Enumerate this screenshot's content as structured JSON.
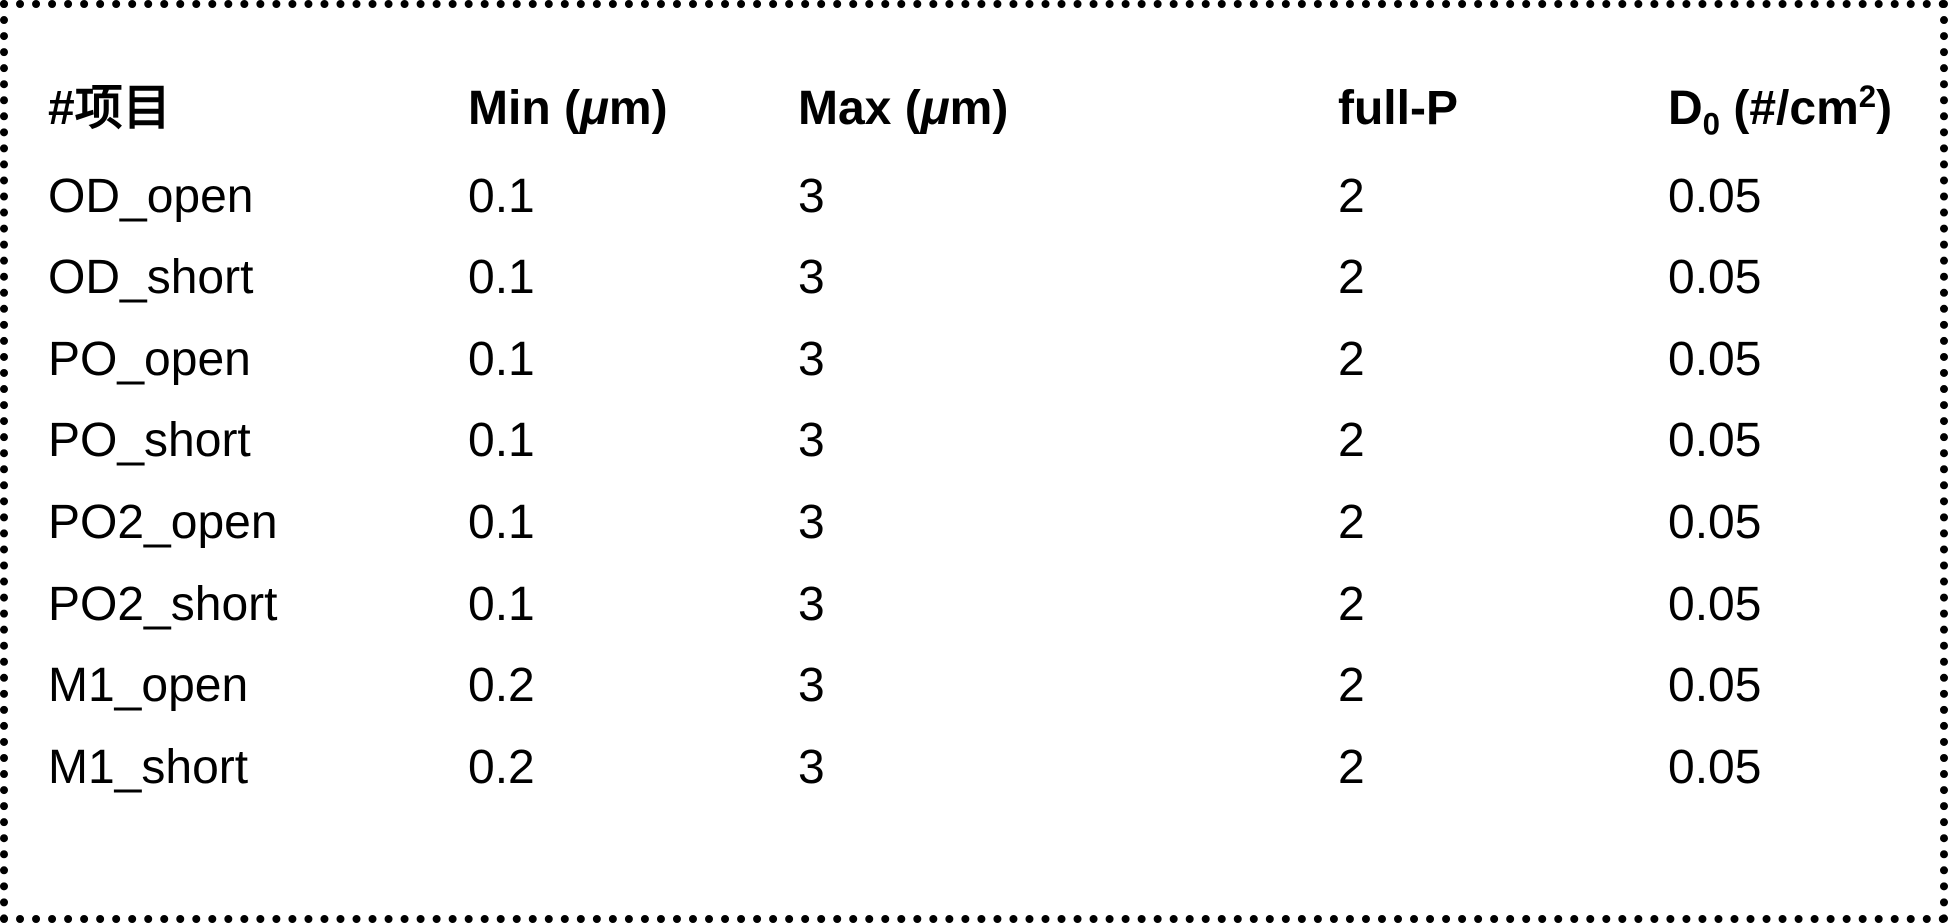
{
  "table": {
    "headers": {
      "item_prefix": "#",
      "item_label": "项目",
      "min_label": "Min (",
      "min_unit_mu": "μ",
      "min_unit_m": "m)",
      "max_label": "Max (",
      "max_unit_mu": "μ",
      "max_unit_m": "m)",
      "fullp": "full-P",
      "d0_prefix": "D",
      "d0_sub": "0",
      "d0_open": " (#/cm",
      "d0_sup": "2",
      "d0_close": ")"
    },
    "rows": [
      {
        "item": "OD_open",
        "min": "0.1",
        "max": "3",
        "fullp": "2",
        "d0": "0.05"
      },
      {
        "item": "OD_short",
        "min": "0.1",
        "max": "3",
        "fullp": "2",
        "d0": "0.05"
      },
      {
        "item": "PO_open",
        "min": "0.1",
        "max": "3",
        "fullp": "2",
        "d0": "0.05"
      },
      {
        "item": "PO_short",
        "min": "0.1",
        "max": "3",
        "fullp": "2",
        "d0": "0.05"
      },
      {
        "item": "PO2_open",
        "min": "0.1",
        "max": "3",
        "fullp": "2",
        "d0": "0.05"
      },
      {
        "item": "PO2_short",
        "min": "0.1",
        "max": "3",
        "fullp": "2",
        "d0": "0.05"
      },
      {
        "item": "M1_open",
        "min": "0.2",
        "max": "3",
        "fullp": "2",
        "d0": "0.05"
      },
      {
        "item": "M1_short",
        "min": "0.2",
        "max": "3",
        "fullp": "2",
        "d0": "0.05"
      }
    ]
  }
}
